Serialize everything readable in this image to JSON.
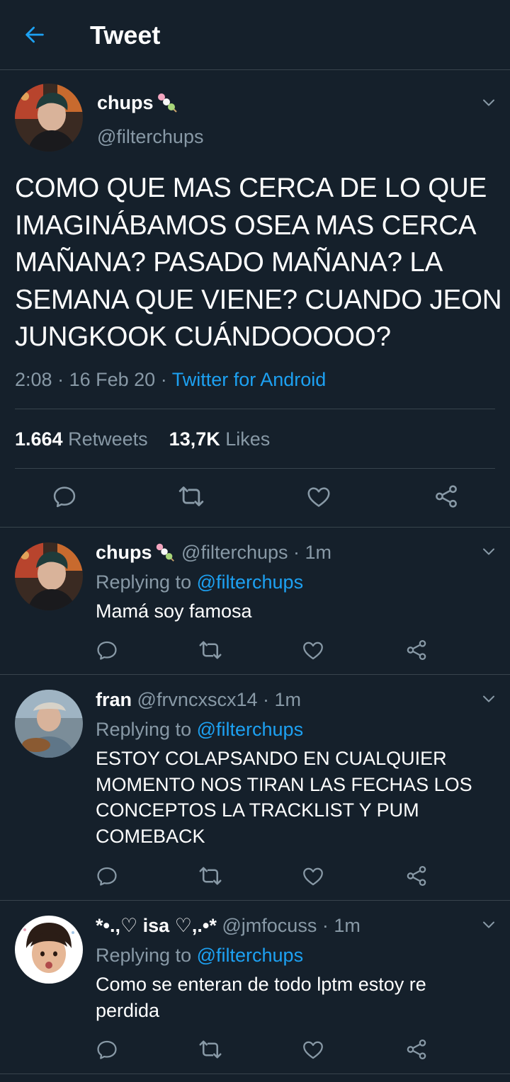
{
  "header": {
    "title": "Tweet"
  },
  "tweet": {
    "name": "chups",
    "handle": "@filterchups",
    "text": "COMO QUE MAS CERCA DE LO QUE IMAGINÁBAMOS OSEA MAS CERCA MAÑANA? PASADO MAÑANA? LA SEMANA QUE VIENE? CUANDO JEON JUNGKOOK CUÁNDOOOOO?",
    "time": "2:08",
    "date": "16 Feb 20",
    "source": "Twitter for Android",
    "retweets": "1.664",
    "retweets_label": "Retweets",
    "likes": "13,7K",
    "likes_label": "Likes"
  },
  "replies": [
    {
      "name": "chups",
      "handle": "@filterchups",
      "age": "1m",
      "replying_prefix": "Replying to",
      "replying_to": "@filterchups",
      "text": "Mamá soy famosa"
    },
    {
      "name": "fran",
      "handle": "@frvncxscx14",
      "age": "1m",
      "replying_prefix": "Replying to",
      "replying_to": "@filterchups",
      "text": "ESTOY COLAPSANDO EN CUALQUIER MOMENTO NOS TIRAN LAS FECHAS LOS CONCEPTOS LA TRACKLIST Y PUM COMEBACK"
    },
    {
      "name": "*•.,♡ isa ♡,.•*",
      "handle": "@jmfocuss",
      "age": "1m",
      "replying_prefix": "Replying to",
      "replying_to": "@filterchups",
      "text": "Como se enteran de todo lptm estoy re perdida"
    }
  ],
  "separators": {
    "dot": "·"
  },
  "icons": {
    "back": "arrow-left-icon",
    "chevron": "chevron-down-icon",
    "reply": "reply-icon",
    "retweet": "retweet-icon",
    "like": "heart-icon",
    "share": "share-icon",
    "emoji": "dango-emoji-icon"
  },
  "colors": {
    "background": "#15202b",
    "accent": "#1da1f2",
    "muted": "#8899a6",
    "divider": "#38444d"
  }
}
